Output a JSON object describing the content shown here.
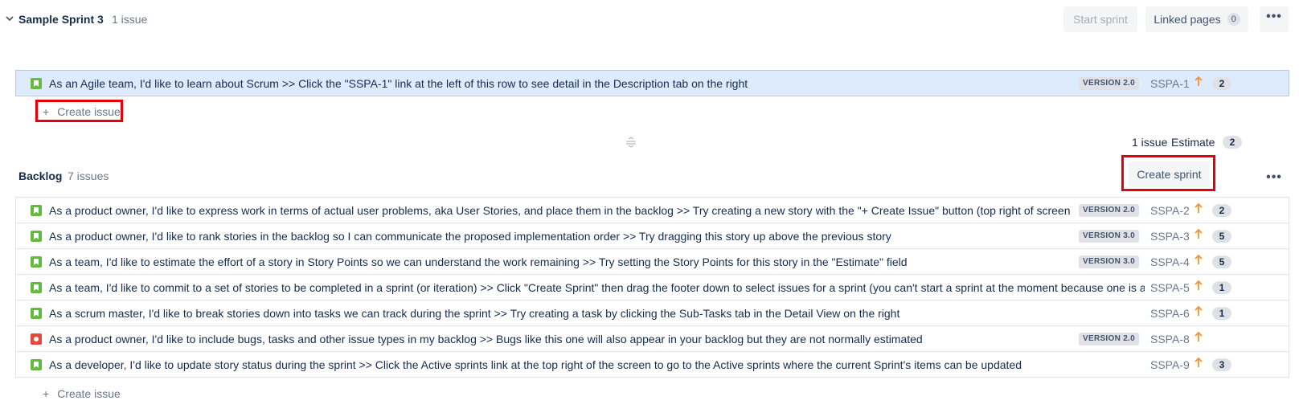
{
  "sprint": {
    "title": "Sample Sprint 3",
    "count": "1 issue",
    "start_label": "Start sprint",
    "linked_label": "Linked pages",
    "linked_count": "0",
    "more_label": "•••",
    "issues": [
      {
        "type": "story",
        "summary": "As an Agile team, I'd like to learn about Scrum >> Click the \"SSPA-1\" link at the left of this row to see detail in the Description tab on the right",
        "version": "VERSION 2.0",
        "key": "SSPA-1",
        "points": "2"
      }
    ],
    "create_label": "Create issue",
    "summary_issues": "1 issue",
    "summary_estimate": "Estimate",
    "summary_points": "2"
  },
  "backlog": {
    "title": "Backlog",
    "count": "7 issues",
    "create_sprint_label": "Create sprint",
    "more_label": "•••",
    "issues": [
      {
        "type": "story",
        "summary": "As a product owner, I'd like to express work in terms of actual user problems, aka User Stories, and place them in the backlog >> Try creating a new story with the \"+ Create Issue\" button (top right of screen)",
        "version": "VERSION 2.0",
        "key": "SSPA-2",
        "points": "2"
      },
      {
        "type": "story",
        "summary": "As a product owner, I'd like to rank stories in the backlog so I can communicate the proposed implementation order >> Try dragging this story up above the previous story",
        "version": "VERSION 3.0",
        "key": "SSPA-3",
        "points": "5"
      },
      {
        "type": "story",
        "summary": "As a team, I'd like to estimate the effort of a story in Story Points so we can understand the work remaining >> Try setting the Story Points for this story in the \"Estimate\" field",
        "version": "VERSION 3.0",
        "key": "SSPA-4",
        "points": "5"
      },
      {
        "type": "story",
        "summary": "As a team, I'd like to commit to a set of stories to be completed in a sprint (or iteration) >> Click \"Create Sprint\" then drag the footer down to select issues for a sprint (you can't start a sprint at the moment because one is already active)",
        "version": "",
        "key": "SSPA-5",
        "points": "1"
      },
      {
        "type": "story",
        "summary": "As a scrum master, I'd like to break stories down into tasks we can track during the sprint >> Try creating a task by clicking the Sub-Tasks tab in the Detail View on the right",
        "version": "",
        "key": "SSPA-6",
        "points": "1"
      },
      {
        "type": "bug",
        "summary": "As a product owner, I'd like to include bugs, tasks and other issue types in my backlog >> Bugs like this one will also appear in your backlog but they are not normally estimated",
        "version": "VERSION 2.0",
        "key": "SSPA-8",
        "points": ""
      },
      {
        "type": "story",
        "summary": "As a developer, I'd like to update story status during the sprint >> Click the Active sprints link at the top right of the screen to go to the Active sprints where the current Sprint's items can be updated",
        "version": "",
        "key": "SSPA-9",
        "points": "3"
      }
    ],
    "create_label": "Create issue"
  },
  "colors": {
    "accent": "#0052cc",
    "story": "#63ba3c",
    "bug": "#e5493a",
    "priority": "#f79232",
    "highlight": "#e5000a",
    "selected_row": "#deebff"
  }
}
